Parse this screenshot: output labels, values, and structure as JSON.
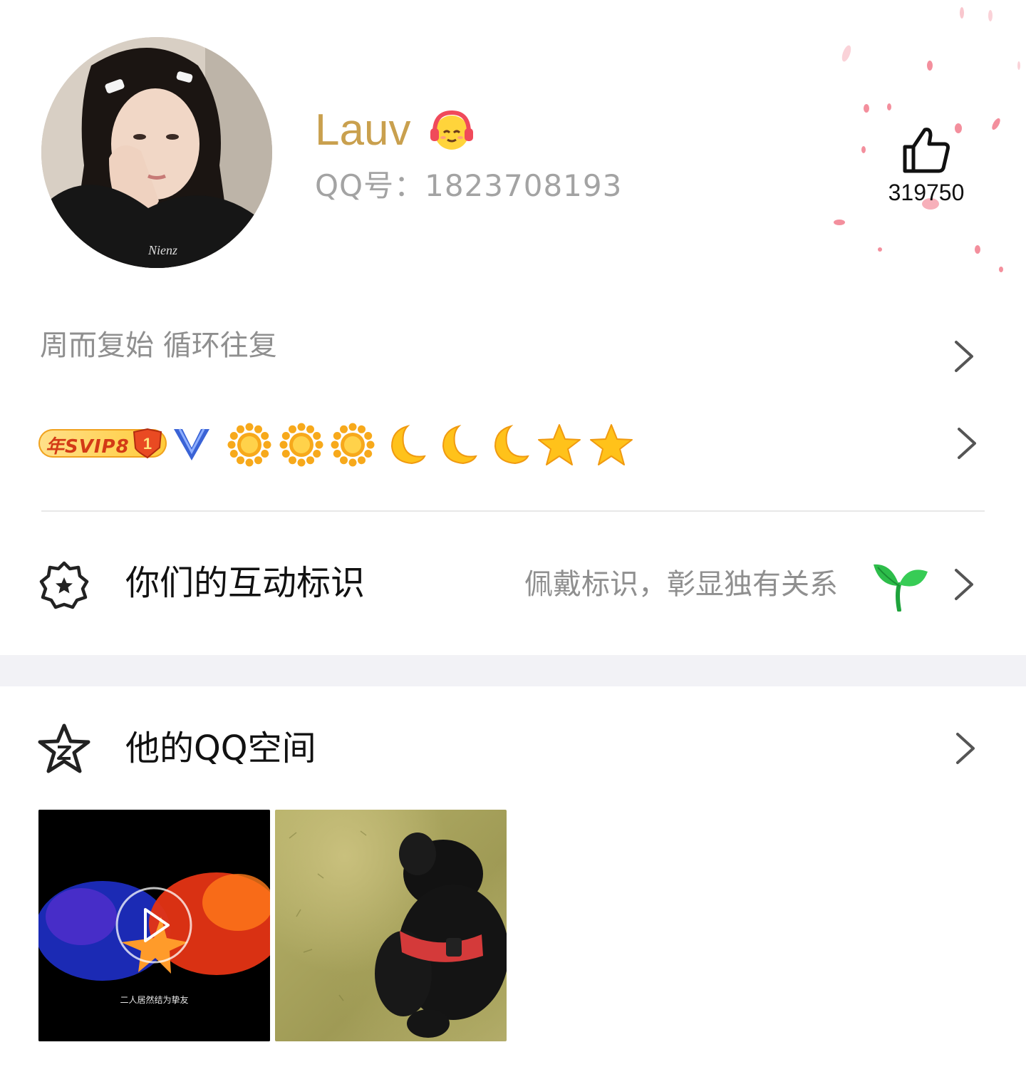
{
  "profile": {
    "nickname": "Lauv",
    "status_icon": "headphones-face-emoji",
    "qq_number": "QQ号：1823708193",
    "likes": "319750"
  },
  "signature": {
    "text": "周而复始  循环往复"
  },
  "badges": {
    "svip_label": "年SVIP8",
    "svip_rank": "1",
    "levels": [
      "sun",
      "sun",
      "sun",
      "moon",
      "moon",
      "moon",
      "star",
      "star"
    ]
  },
  "interaction": {
    "title": "你们的互动标识",
    "hint": "佩戴标识，彰显独有关系",
    "icon": "sprout-icon"
  },
  "qzone": {
    "title": "他的QQ空间",
    "video_caption": "二人居然结为挚友",
    "photos": [
      "video-thumbnail",
      "dog-photo"
    ]
  },
  "colors": {
    "nickname": "#c9a04e",
    "secondary_text": "#8f8f8f",
    "section_gap": "#f2f2f6",
    "petal": "#f06b7e"
  }
}
